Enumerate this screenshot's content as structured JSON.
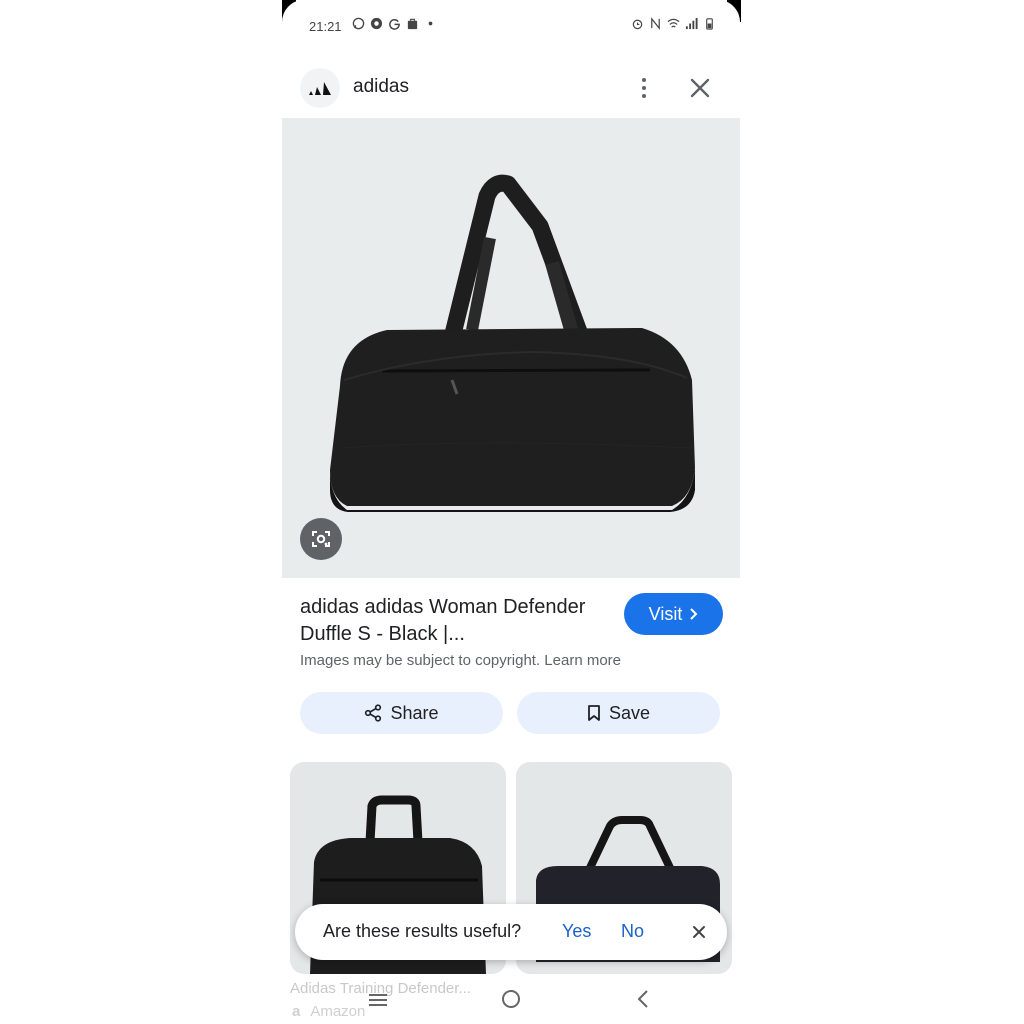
{
  "status_bar": {
    "time": "21:21",
    "left_icons": [
      "whatsapp-icon",
      "chrome-icon",
      "google-icon",
      "bag-icon",
      "dot-icon"
    ],
    "right_icons": [
      "alarm-icon",
      "nfc-icon",
      "wifi-icon",
      "signal-icon",
      "battery-icon"
    ]
  },
  "header": {
    "site_name": "adidas",
    "logo": "adidas-logo-icon",
    "more_icon": "more-vert-icon",
    "close_icon": "close-icon"
  },
  "result": {
    "title": "adidas adidas Woman Defender Duffle S - Black |...",
    "visit_label": "Visit",
    "copyright_text": "Images may be subject to copyright.",
    "learn_more": "Learn more",
    "share_label": "Share",
    "save_label": "Save"
  },
  "related": {
    "item1_caption": "Adidas Training Defender...",
    "item1_source": "Amazon"
  },
  "feedback": {
    "question": "Are these results useful?",
    "yes": "Yes",
    "no": "No"
  },
  "colors": {
    "accent": "#1a73e8",
    "pill_bg": "#e8f0fe",
    "hero_bg": "#e9eced"
  }
}
